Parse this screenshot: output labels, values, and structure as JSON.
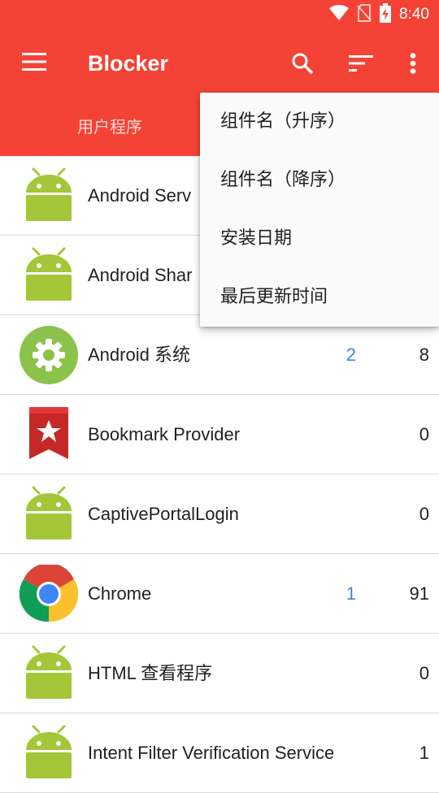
{
  "status_bar": {
    "time": "8:40"
  },
  "app_bar": {
    "title": "Blocker",
    "tabs": [
      {
        "label": "用户程序"
      }
    ],
    "icons": {
      "menu": "hamburger-menu-icon",
      "search": "search-icon",
      "sort": "sort-icon",
      "more": "more-vert-icon"
    }
  },
  "sort_menu": {
    "items": [
      {
        "label": "组件名（升序）"
      },
      {
        "label": "组件名（降序）"
      },
      {
        "label": "安装日期"
      },
      {
        "label": "最后更新时间"
      }
    ]
  },
  "apps": [
    {
      "name": "Android Serv",
      "blocked": "",
      "total": "",
      "icon": "android-icon"
    },
    {
      "name": "Android Shar",
      "blocked": "",
      "total": "",
      "icon": "android-icon"
    },
    {
      "name": "Android 系统",
      "blocked": "2",
      "total": "8",
      "icon": "settings-gear-icon"
    },
    {
      "name": "Bookmark Provider",
      "blocked": "",
      "total": "0",
      "icon": "bookmark-icon"
    },
    {
      "name": "CaptivePortalLogin",
      "blocked": "",
      "total": "0",
      "icon": "android-icon"
    },
    {
      "name": "Chrome",
      "blocked": "1",
      "total": "91",
      "icon": "chrome-icon"
    },
    {
      "name": "HTML 查看程序",
      "blocked": "",
      "total": "0",
      "icon": "android-icon"
    },
    {
      "name": "Intent Filter Verification Service",
      "blocked": "",
      "total": "1",
      "icon": "android-icon"
    }
  ],
  "colors": {
    "primary": "#f44336",
    "accent_count": "#3f87d6",
    "android_green": "#a4c639"
  }
}
